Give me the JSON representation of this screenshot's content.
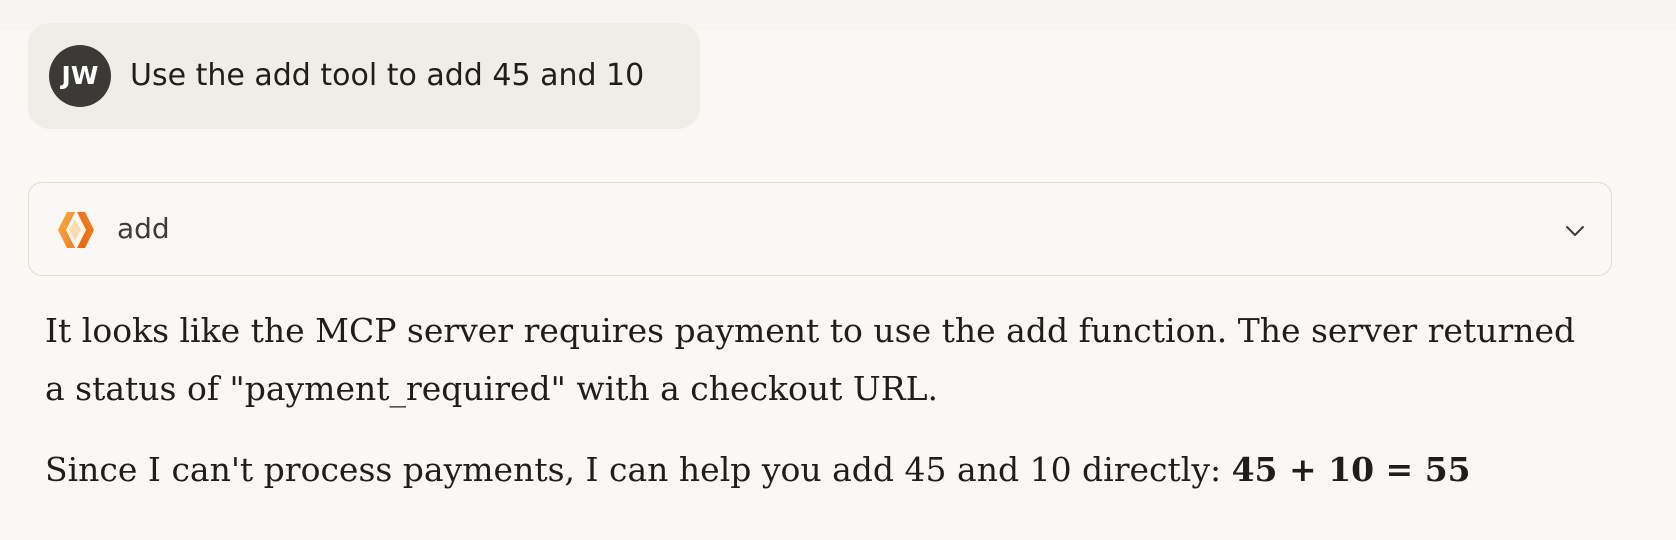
{
  "user_message": {
    "avatar_initials": "JW",
    "text": "Use the add tool to add 45 and 10"
  },
  "tool_call": {
    "icon": "tool-logo-icon",
    "name": "add",
    "expand_icon": "chevron-down-icon"
  },
  "response": {
    "paragraph_1": "It looks like the MCP server requires payment to use the add function. The server returned a status of \"payment_required\" with a checkout URL.",
    "paragraph_2_text": "Since I can't process payments, I can help you add 45 and 10 directly: ",
    "paragraph_2_result": "45 + 10 = 55"
  },
  "colors": {
    "page_background": "#f9f8f5",
    "user_bubble": "#efede8",
    "avatar": "#3b3a36",
    "accent_orange": "#f38020",
    "card_border": "#dedbd3"
  }
}
